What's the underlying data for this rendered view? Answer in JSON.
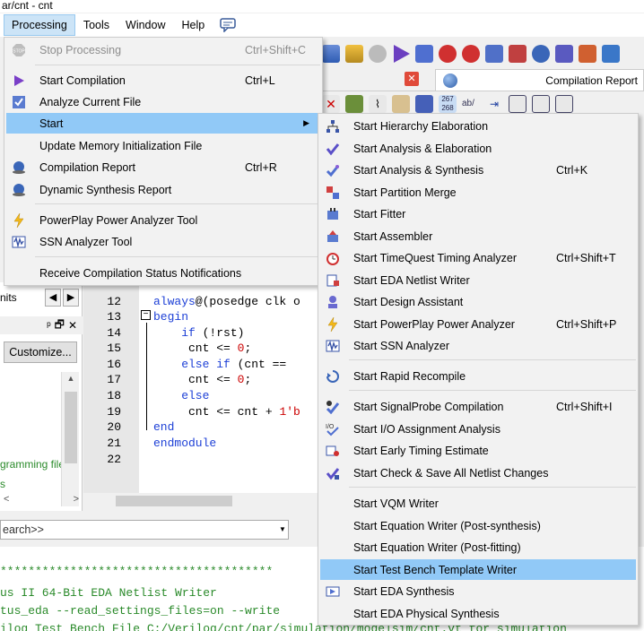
{
  "window": {
    "title": "ar/cnt - cnt"
  },
  "menubar": {
    "items": [
      "Processing",
      "Tools",
      "Window",
      "Help"
    ],
    "active": "Processing"
  },
  "tabs": {
    "compilation_report": "Compilation Report",
    "close": "✕"
  },
  "left_pane": {
    "units_tab": "nits",
    "customize_label": "Customize...",
    "programming_file": "gramming file",
    "files_text": "s",
    "pane_controls": [
      "ᵖ",
      "🗗",
      "✕"
    ]
  },
  "editor": {
    "line_numbers": [
      "12",
      "13",
      "14",
      "15",
      "16",
      "17",
      "18",
      "19",
      "20",
      "21",
      "22"
    ],
    "code": {
      "l12a": "always",
      "l12b": "@(posedge clk o",
      "l13": "begin",
      "l14a": "    if",
      "l14b": " (!rst)",
      "l15a": "     cnt <= ",
      "l15b": "0",
      "l15c": ";",
      "l16a": "    else if",
      "l16b": " (cnt == ",
      "l17a": "     cnt <= ",
      "l17b": "0",
      "l17c": ";",
      "l18": "    else",
      "l19a": "     cnt <= cnt + ",
      "l19b": "1'b",
      "l20": "end",
      "l21": "endmodule"
    }
  },
  "search": {
    "value": "earch>>"
  },
  "messages": {
    "line1": "***************************************",
    "line2": "us II 64-Bit EDA Netlist Writer",
    "line3": "tus_eda --read_settings_files=on --write",
    "line4": "ilog Test Bench File C:/Verilog/cnt/par/simulation/modelsim/cnt.vt for simulation"
  },
  "processing_menu": {
    "items": [
      {
        "label": "Stop Processing",
        "shortcut": "Ctrl+Shift+C",
        "icon": "stop-icon",
        "disabled": true
      },
      {
        "label": "Start Compilation",
        "shortcut": "Ctrl+L",
        "icon": "play-icon"
      },
      {
        "label": "Analyze Current File",
        "shortcut": "",
        "icon": "analyze-icon"
      },
      {
        "label": "Start",
        "shortcut": "",
        "icon": "",
        "submenu": true,
        "highlight": true
      },
      {
        "label": "Update Memory Initialization File",
        "shortcut": "",
        "icon": ""
      },
      {
        "label": "Compilation Report",
        "shortcut": "Ctrl+R",
        "icon": "report-icon"
      },
      {
        "label": "Dynamic Synthesis Report",
        "shortcut": "",
        "icon": "report-icon"
      },
      {
        "label": "PowerPlay Power Analyzer Tool",
        "shortcut": "",
        "icon": "lightning-icon"
      },
      {
        "label": "SSN Analyzer Tool",
        "shortcut": "",
        "icon": "ssn-icon"
      },
      {
        "label": "Receive Compilation Status Notifications",
        "shortcut": "",
        "icon": ""
      }
    ]
  },
  "start_submenu": {
    "items": [
      {
        "label": "Start Hierarchy Elaboration",
        "shortcut": "",
        "icon": "hierarchy-icon"
      },
      {
        "label": "Start Analysis & Elaboration",
        "shortcut": "",
        "icon": "check-icon"
      },
      {
        "label": "Start Analysis & Synthesis",
        "shortcut": "Ctrl+K",
        "icon": "synthesis-icon"
      },
      {
        "label": "Start Partition Merge",
        "shortcut": "",
        "icon": "partition-icon"
      },
      {
        "label": "Start Fitter",
        "shortcut": "",
        "icon": "fitter-icon"
      },
      {
        "label": "Start Assembler",
        "shortcut": "",
        "icon": "assembler-icon"
      },
      {
        "label": "Start TimeQuest Timing Analyzer",
        "shortcut": "Ctrl+Shift+T",
        "icon": "timer-icon"
      },
      {
        "label": "Start EDA Netlist Writer",
        "shortcut": "",
        "icon": "netlist-icon"
      },
      {
        "label": "Start Design Assistant",
        "shortcut": "",
        "icon": "assistant-icon"
      },
      {
        "label": "Start PowerPlay Power Analyzer",
        "shortcut": "Ctrl+Shift+P",
        "icon": "lightning-icon"
      },
      {
        "label": "Start SSN Analyzer",
        "shortcut": "",
        "icon": "ssn-icon"
      },
      {
        "label": "Start Rapid Recompile",
        "shortcut": "",
        "icon": "recompile-icon"
      },
      {
        "label": "Start SignalProbe Compilation",
        "shortcut": "Ctrl+Shift+I",
        "icon": "signalprobe-icon"
      },
      {
        "label": "Start I/O Assignment Analysis",
        "shortcut": "",
        "icon": "io-icon"
      },
      {
        "label": "Start Early Timing Estimate",
        "shortcut": "",
        "icon": "estimate-icon"
      },
      {
        "label": "Start Check & Save All Netlist Changes",
        "shortcut": "",
        "icon": "save-check-icon"
      },
      {
        "label": "Start VQM Writer",
        "shortcut": "",
        "icon": ""
      },
      {
        "label": "Start Equation Writer (Post-synthesis)",
        "shortcut": "",
        "icon": ""
      },
      {
        "label": "Start Equation Writer (Post-fitting)",
        "shortcut": "",
        "icon": ""
      },
      {
        "label": "Start Test Bench Template Writer",
        "shortcut": "",
        "icon": "",
        "highlight": true
      },
      {
        "label": "Start EDA Synthesis",
        "shortcut": "",
        "icon": "eda-synthesis-icon"
      },
      {
        "label": "Start EDA Physical Synthesis",
        "shortcut": "",
        "icon": ""
      }
    ]
  },
  "colors": {
    "highlight": "#91c9f7",
    "menu_bg": "#f2f2f2",
    "keyword": "#1c3fd6",
    "message": "#2a8a2a"
  }
}
